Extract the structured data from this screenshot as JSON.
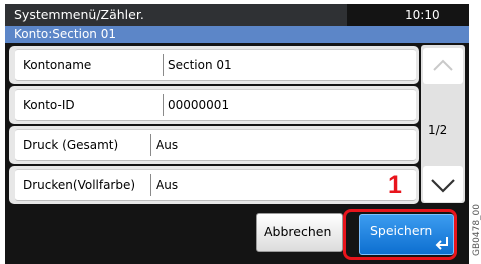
{
  "header": {
    "title": "Systemmenü/Zähler.",
    "clock": "10:10"
  },
  "subheader": {
    "title": "Konto:Section 01"
  },
  "rows": [
    {
      "label": "Kontoname",
      "value": "Section 01"
    },
    {
      "label": "Konto-ID",
      "value": "00000001"
    },
    {
      "label": "Druck (Gesamt)",
      "value": "Aus"
    },
    {
      "label": "Drucken(Vollfarbe)",
      "value": "Aus"
    }
  ],
  "pager": {
    "text": "1/2",
    "up_icon": "chevron-up-icon",
    "down_icon": "chevron-down-icon"
  },
  "buttons": {
    "cancel_label": "Abbrechen",
    "save_label": "Speichern",
    "save_icon": "enter-icon"
  },
  "annotation": {
    "callout_number": "1",
    "figure_code": "GB0478_00"
  },
  "colors": {
    "accent_blue": "#1a7ee0",
    "header_blue": "#5c86c8",
    "callout_red": "#e8141c"
  }
}
